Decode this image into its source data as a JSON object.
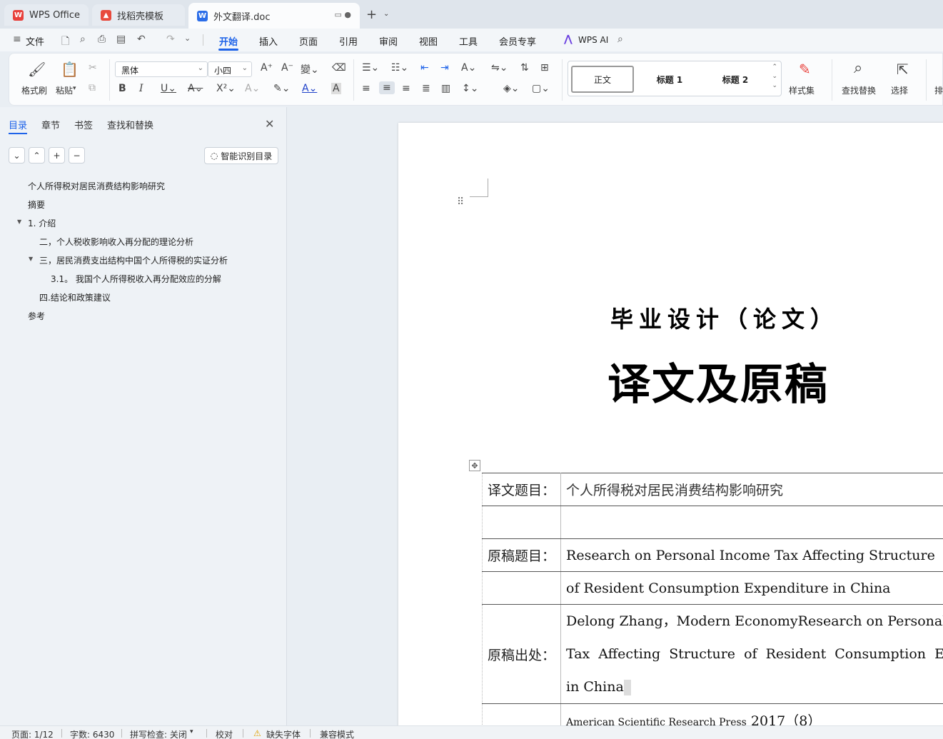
{
  "tabs": {
    "wps": "WPS Office",
    "templates": "找稻壳模板",
    "doc": "外文翻译.doc"
  },
  "menu": {
    "file": "文件",
    "items": [
      "开始",
      "插入",
      "页面",
      "引用",
      "审阅",
      "视图",
      "工具",
      "会员专享"
    ],
    "active": "开始",
    "wps_ai": "WPS AI"
  },
  "ribbon": {
    "format_painter": "格式刷",
    "paste": "粘贴",
    "font_name": "黑体",
    "font_size": "小四",
    "styles": [
      "正文",
      "标题 1",
      "标题 2"
    ],
    "style_set": "样式集",
    "find_replace": "查找替换",
    "select": "选择",
    "arrange": "排"
  },
  "nav": {
    "tabs": [
      "目录",
      "章节",
      "书签",
      "查找和替换"
    ],
    "smart_toc": "智能识别目录",
    "toc": [
      "个人所得税对居民消费结构影响研究",
      "摘要",
      "1. 介绍",
      "二，个人税收影响收入再分配的理论分析",
      "三，居民消费支出结构中国个人所得税的实证分析",
      "3.1。 我国个人所得税收入再分配效应的分解",
      "四.结论和政策建议",
      "参考"
    ]
  },
  "document": {
    "title_line1": "毕业设计（论文）",
    "title_line2": "译文及原稿",
    "rows": [
      {
        "label": "译文题目：",
        "value": "个人所得税对居民消费结构影响研究"
      },
      {
        "label": "",
        "value": ""
      },
      {
        "label": "原稿题目：",
        "value": "Research on Personal Income Tax Affecting Structure"
      },
      {
        "label": "",
        "value": "of Resident Consumption Expenditure in China"
      },
      {
        "label": "原稿出处：",
        "value1": "Delong Zhang，Modern EconomyResearch on Personal Income",
        "value2": "Tax Affecting Structure of Resident Consumption Expenditure",
        "value3": "in China"
      },
      {
        "label": "",
        "value_a": "American Scientific Research Press",
        "value_b": "2017（8）"
      }
    ]
  },
  "status": {
    "page": "页面: 1/12",
    "words": "字数: 6430",
    "spell": "拼写检查: 关闭",
    "proof": "校对",
    "missing_font": "缺失字体",
    "compat": "兼容模式"
  },
  "colors": {
    "accent": "#1e63e9",
    "wps_red": "#e8413c"
  }
}
